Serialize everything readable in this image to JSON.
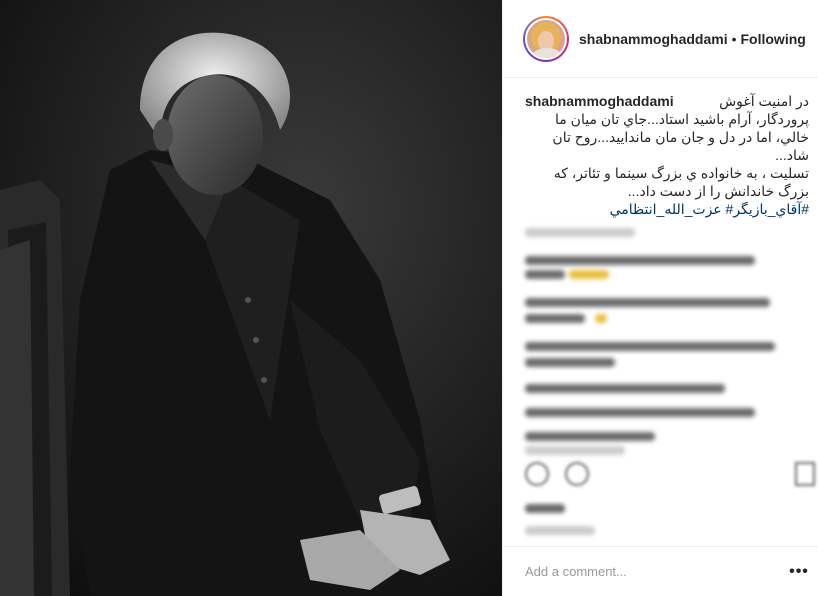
{
  "post": {
    "username": "shabnammoghaddami",
    "separator": "•",
    "follow_status": "Following"
  },
  "caption": {
    "username": "shabnammoghaddami",
    "line1": "در امنيت آغوش",
    "line2": "پروردگار، آرام باشيد استاد...جاي تان ميان ما",
    "line3": "خالي، اما در دل و جان مان مانداييد...روح تان",
    "line4": "شاد...",
    "line5": "تسليت ، به خانواده ي بزرگ سينما و تئاتر، كه",
    "line6": "بزرگ خاندانش را از دست داد...",
    "hashtags": "#آقاي_بازيگر# عزت_الله_انتظامي"
  },
  "comment_box": {
    "placeholder": "Add a comment...",
    "more_label": "•••"
  },
  "icons": {
    "more": "more-options-icon",
    "like": "heart-icon",
    "comment": "comment-icon",
    "save": "bookmark-icon"
  }
}
